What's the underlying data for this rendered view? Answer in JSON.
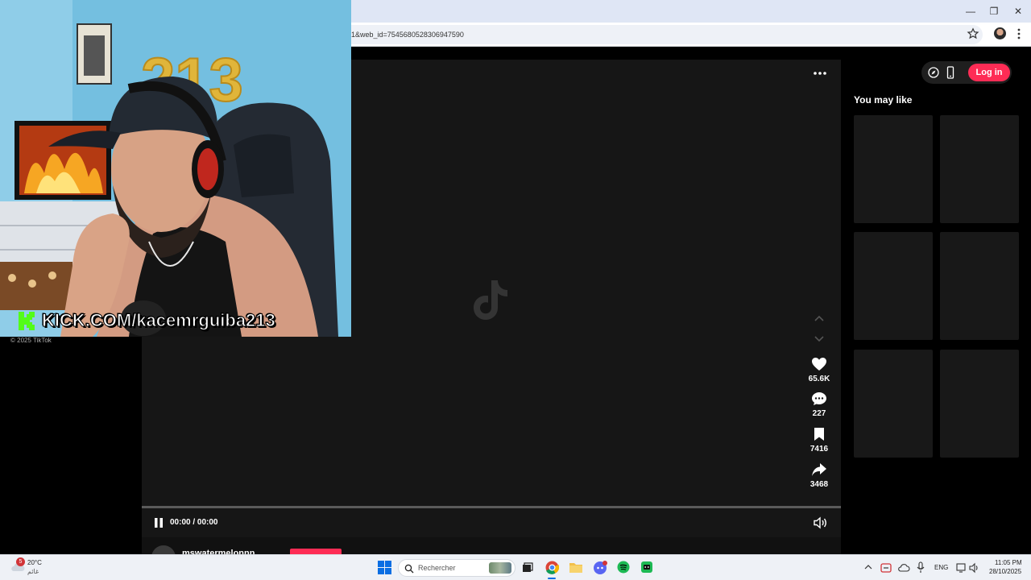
{
  "browser": {
    "url_fragment": "1&web_id=7545680528306947590",
    "window_controls": [
      "—",
      "❐",
      "✕"
    ]
  },
  "video": {
    "time": "00:00 / 00:00",
    "actions": [
      {
        "name": "like",
        "count": "65.6K"
      },
      {
        "name": "comment",
        "count": "227"
      },
      {
        "name": "save",
        "count": "7416"
      },
      {
        "name": "share",
        "count": "3468"
      }
    ],
    "author": "mswatermelonnn"
  },
  "header": {
    "login_label": "Log in"
  },
  "sidebar": {
    "title": "You may like"
  },
  "footer": {
    "copyright": "© 2025 TikTok"
  },
  "webcam": {
    "overlay_text": "KICK.COM/kacemrguiba213",
    "badge_letter": "K",
    "balloon_text": "213"
  },
  "taskbar": {
    "weather_badge": "5",
    "temperature": "20°C",
    "weather_sub": "غائم",
    "search_placeholder": "Rechercher",
    "language": "ENG",
    "time": "11:05 PM",
    "date": "28/10/2025"
  },
  "colors": {
    "accent": "#fe2c55",
    "player_bg": "#161616",
    "taskbar_bg": "#eef1f6",
    "kick_green": "#53fc18"
  }
}
